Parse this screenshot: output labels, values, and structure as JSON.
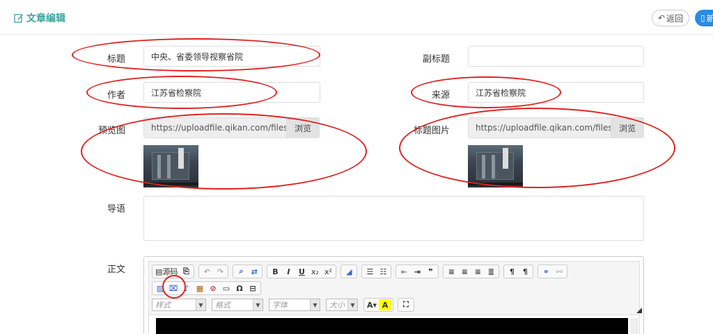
{
  "header": {
    "title": "文章编辑",
    "back_label": "返回",
    "new_label": "新"
  },
  "form": {
    "title_label": "标题",
    "title_value": "中央、省委领导视察省院",
    "subtitle_label": "副标题",
    "subtitle_value": "",
    "author_label": "作者",
    "author_value": "江苏省检察院",
    "source_label": "来源",
    "source_value": "江苏省检察院",
    "preview_label": "预览图",
    "preview_path": "https://uploadfile.qikan.com/files/p",
    "preview_browse": "浏览",
    "titleimg_label": "标题图片",
    "titleimg_path": "https://uploadfile.qikan.com/files/p",
    "titleimg_browse": "浏览",
    "lead_label": "导语",
    "lead_value": "",
    "body_label": "正文"
  },
  "editor": {
    "source_label": "源码",
    "format_placeholder": "样式",
    "font_format_placeholder": "格式",
    "font_placeholder": "字体",
    "size_placeholder": "大小"
  },
  "colors": {
    "accent": "#3aa6a0",
    "primary": "#2a8be0",
    "annotation": "#e02020"
  }
}
